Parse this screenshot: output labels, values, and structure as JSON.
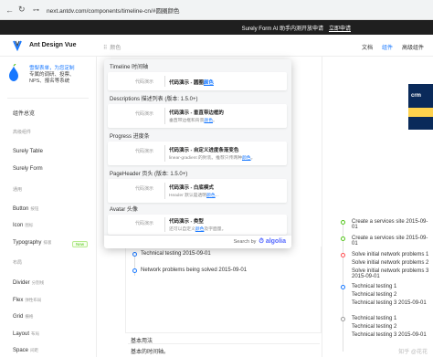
{
  "browser": {
    "url": "next.antdv.com/components/timeline-cn/#圆圈颜色"
  },
  "banner": {
    "text": "Surely Form AI 助手内测开放申请",
    "link": "立即申请"
  },
  "topnav": {
    "logo_text": "Ant Design Vue",
    "search_text": "颜色",
    "items": [
      {
        "label": "文档",
        "active": false
      },
      {
        "label": "组件",
        "active": true
      },
      {
        "label": "高级组件",
        "active": false
      }
    ]
  },
  "sidebar": {
    "promo_line1": "雪梨表单，为您定制",
    "promo_line2": "专属的调研、投票、",
    "promo_line3": "NPS、报名等系统",
    "overview": "组件总览",
    "groups": [
      {
        "label": "高级组件"
      },
      {
        "label": "通用"
      },
      {
        "label": "布局"
      }
    ],
    "items": [
      {
        "label": "Surely Table",
        "sub": ""
      },
      {
        "label": "Surely Form",
        "sub": ""
      },
      {
        "label": "Button",
        "sub": "按钮"
      },
      {
        "label": "Icon",
        "sub": "图标"
      },
      {
        "label": "Typography",
        "sub": "排版"
      },
      {
        "label": "Divider",
        "sub": "分割线"
      },
      {
        "label": "Flex",
        "sub": "弹性布局"
      },
      {
        "label": "Grid",
        "sub": "栅格"
      },
      {
        "label": "Layout",
        "sub": "布局"
      },
      {
        "label": "Space",
        "sub": "间距"
      }
    ],
    "new_badge": "New"
  },
  "search_modal": {
    "sections": [
      {
        "title": "Timeline 时间轴"
      },
      {
        "title": "Descriptions 描述列表 (版本: 1.5.0+)"
      },
      {
        "title": "Progress 进度条"
      },
      {
        "title": "PageHeader 页头 (版本: 1.5.0+)"
      },
      {
        "title": "Avatar 头像"
      }
    ],
    "cards": [
      {
        "label": "代码演示",
        "title_pre": "代码演示 - 圆圈",
        "title_hl": "颜色",
        "desc_pre": "",
        "desc_hl": "",
        "desc_post": ""
      },
      {
        "label": "代码演示",
        "title_pre": "代码演示 - 垂直带边框的",
        "title_hl": "",
        "desc_pre": "垂直带边框和背景",
        "desc_hl": "颜色",
        "desc_post": "。"
      },
      {
        "label": "代码演示",
        "title_pre": "代码演示 - 自定义进度条渐变色",
        "title_hl": "",
        "desc_pre": "linear-gradient 的封装。推荐只传两种",
        "desc_hl": "颜色",
        "desc_post": "。"
      },
      {
        "label": "代码演示",
        "title_pre": "代码演示 - 白底模式",
        "title_hl": "",
        "desc_pre": "Header 默认是透明",
        "desc_hl": "颜色",
        "desc_post": "..."
      },
      {
        "label": "代码演示",
        "title_pre": "代码演示 - 类型",
        "title_hl": "",
        "desc_pre": "还可以自定义",
        "desc_hl": "颜色",
        "desc_post": "及字面量。"
      }
    ],
    "footer_search_by": "Search by",
    "footer_brand": "algolia"
  },
  "timeline_left": {
    "items": [
      {
        "text": "Technical testing 2015-09-01"
      },
      {
        "text": "Network problems being solved 2015-09-01"
      }
    ]
  },
  "bottom": {
    "title": "基本用法",
    "subtitle": "基本的时间轴。"
  },
  "right_timeline": {
    "items": [
      {
        "text": "Create a services site 2015-09-01",
        "color": "#52c41a"
      },
      {
        "text": "Create a services site 2015-09-01",
        "color": "#52c41a"
      },
      {
        "text": "Solve initial network problems 1",
        "color": "#ff4d4f"
      },
      {
        "text": "Solve initial network problems 2",
        "color": ""
      },
      {
        "text": "Solve initial network problems 3 2015-09-01",
        "color": ""
      },
      {
        "text": "Technical testing 1",
        "color": "#1677ff"
      },
      {
        "text": "Technical testing 2",
        "color": ""
      },
      {
        "text": "Technical testing 3 2015-09-01",
        "color": ""
      },
      {
        "text": "Technical testing 1",
        "color": "#999999"
      },
      {
        "text": "Technical testing 2",
        "color": ""
      },
      {
        "text": "Technical testing 3 2015-09-01",
        "color": ""
      }
    ]
  },
  "watermark": "知乎 @花花"
}
